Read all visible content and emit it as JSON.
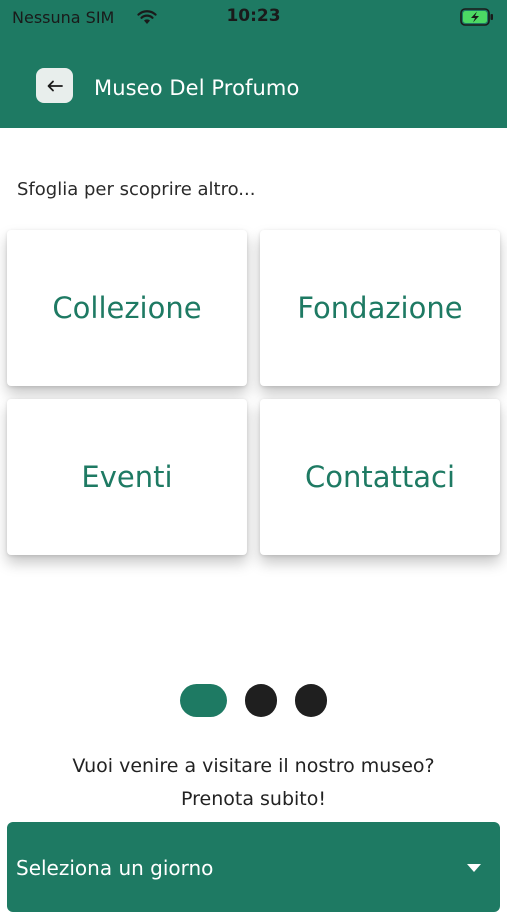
{
  "status_bar": {
    "carrier": "Nessuna SIM",
    "time": "10:23"
  },
  "header": {
    "title": "Museo Del Profumo",
    "back_icon": "arrow-left-icon",
    "background_color": "#1e7a63"
  },
  "main": {
    "subtitle": "Sfoglia per scoprire altro...",
    "cards": [
      {
        "label": "Collezione"
      },
      {
        "label": "Fondazione"
      },
      {
        "label": "Eventi"
      },
      {
        "label": "Contattaci"
      }
    ],
    "pager": {
      "total": 3,
      "active_index": 0
    }
  },
  "booking": {
    "line1": "Vuoi venire a visitare il nostro museo?",
    "line2": "Prenota subito!",
    "select_label": "Seleziona un giorno"
  },
  "colors": {
    "accent": "#1e7a63",
    "dot_inactive": "#1f1f1f"
  }
}
